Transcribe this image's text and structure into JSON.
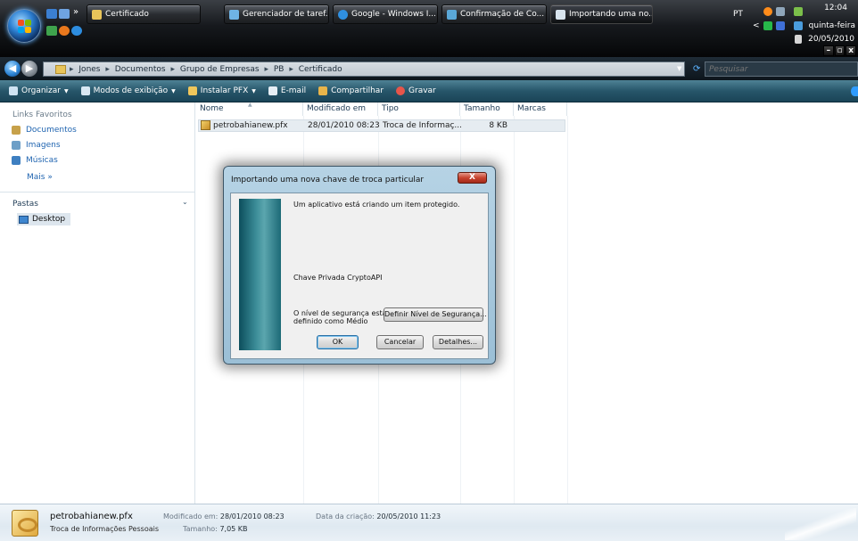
{
  "colors": {
    "accent": "#27566a",
    "taskbar": "#16191d",
    "link": "#1f64b0",
    "close": "#c8432e"
  },
  "taskbar": {
    "chevron": "»",
    "buttons": [
      {
        "label": "Certificado",
        "icon": "folder-icon"
      },
      {
        "label": "Gerenciador de taref...",
        "icon": "task-manager-icon"
      },
      {
        "label": "Google - Windows I...",
        "icon": "ie-icon"
      },
      {
        "label": "Confirmação de Co...",
        "icon": "window-icon"
      },
      {
        "label": "Importando uma no...",
        "icon": "dialog-icon"
      }
    ],
    "language": "PT",
    "clock": {
      "time": "12:04",
      "day": "quinta-feira",
      "date": "20/05/2010"
    },
    "window_controls": [
      "–",
      "▫",
      "x"
    ]
  },
  "address": {
    "crumbs": [
      "Jones",
      "Documentos",
      "Grupo de Empresas",
      "PB",
      "Certificado"
    ],
    "separator": "▸",
    "search_placeholder": "Pesquisar"
  },
  "command_bar": {
    "items": [
      {
        "label": "Organizar",
        "dropdown": true
      },
      {
        "label": "Modos de exibição",
        "dropdown": true
      },
      {
        "label": "Instalar PFX",
        "dropdown": true
      },
      {
        "label": "E-mail",
        "dropdown": false
      },
      {
        "label": "Compartilhar",
        "dropdown": false
      },
      {
        "label": "Gravar",
        "dropdown": false
      }
    ],
    "dd_glyph": "▼"
  },
  "nav": {
    "favorites_title": "Links Favoritos",
    "favorites": [
      "Documentos",
      "Imagens",
      "Músicas"
    ],
    "more": "Mais »",
    "folders_title": "Pastas",
    "folders_chevron": "⌄",
    "tree": [
      "Desktop"
    ]
  },
  "files": {
    "columns": [
      "Nome",
      "Modificado em",
      "Tipo",
      "Tamanho",
      "Marcas"
    ],
    "rows": [
      {
        "name": "petrobahianew.pfx",
        "modified": "28/01/2010 08:23",
        "type": "Troca de Informaç...",
        "size": "8 KB",
        "tags": ""
      }
    ]
  },
  "dialog": {
    "title": "Importando uma nova chave de troca particular",
    "close": "X",
    "message": "Um aplicativo está criando um item protegido.",
    "key_label": "Chave Privada CryptoAPI",
    "security_line1": "O nível de segurança está",
    "security_line2": "definido como Médio",
    "set_level_button": "Definir Nível de Segurança...",
    "ok_button": "OK",
    "cancel_button": "Cancelar",
    "details_button": "Detalhes..."
  },
  "details": {
    "name": "petrobahianew.pfx",
    "type": "Troca de Informações Pessoais",
    "modified_label": "Modificado em:",
    "modified_value": "28/01/2010 08:23",
    "size_label": "Tamanho:",
    "size_value": "7,05 KB",
    "created_label": "Data da criação:",
    "created_value": "20/05/2010 11:23"
  }
}
